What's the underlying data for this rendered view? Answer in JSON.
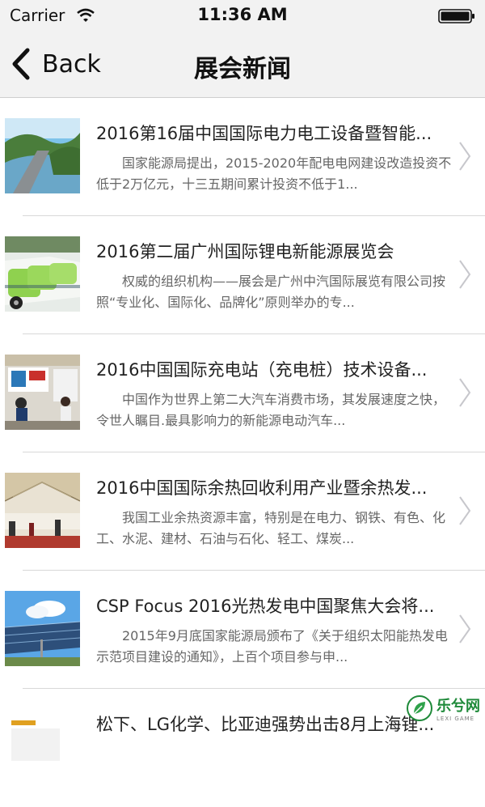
{
  "status_bar": {
    "carrier": "Carrier",
    "time": "11:36 AM"
  },
  "nav": {
    "back_label": "Back",
    "title": "展会新闻"
  },
  "news": [
    {
      "title": "2016第16届中国国际电力电工设备暨智能...",
      "summary": "国家能源局提出，2015-2020年配电电网建设改造投资不低于2万亿元，十三五期间累计投资不低于1..."
    },
    {
      "title": "2016第二届广州国际锂电新能源展览会",
      "summary": "权威的组织机构——展会是广州中汽国际展览有限公司按照“专业化、国际化、品牌化”原则举办的专..."
    },
    {
      "title": "2016中国国际充电站（充电桩）技术设备...",
      "summary": "中国作为世界上第二大汽车消费市场，其发展速度之快，令世人瞩目.最具影响力的新能源电动汽车..."
    },
    {
      "title": "2016中国国际余热回收利用产业暨余热发...",
      "summary": "我国工业余热资源丰富，特别是在电力、钢铁、有色、化工、水泥、建材、石油与石化、轻工、煤炭..."
    },
    {
      "title": "CSP Focus 2016光热发电中国聚焦大会将...",
      "summary": "2015年9月底国家能源局颁布了《关于组织太阳能热发电示范项目建设的通知》，上百个项目参与申..."
    },
    {
      "title": "松下、LG化学、比亚迪强势出击8月上海锂...",
      "summary": ""
    }
  ],
  "watermark": {
    "name": "乐兮网",
    "tag": "LEXI GAME"
  }
}
